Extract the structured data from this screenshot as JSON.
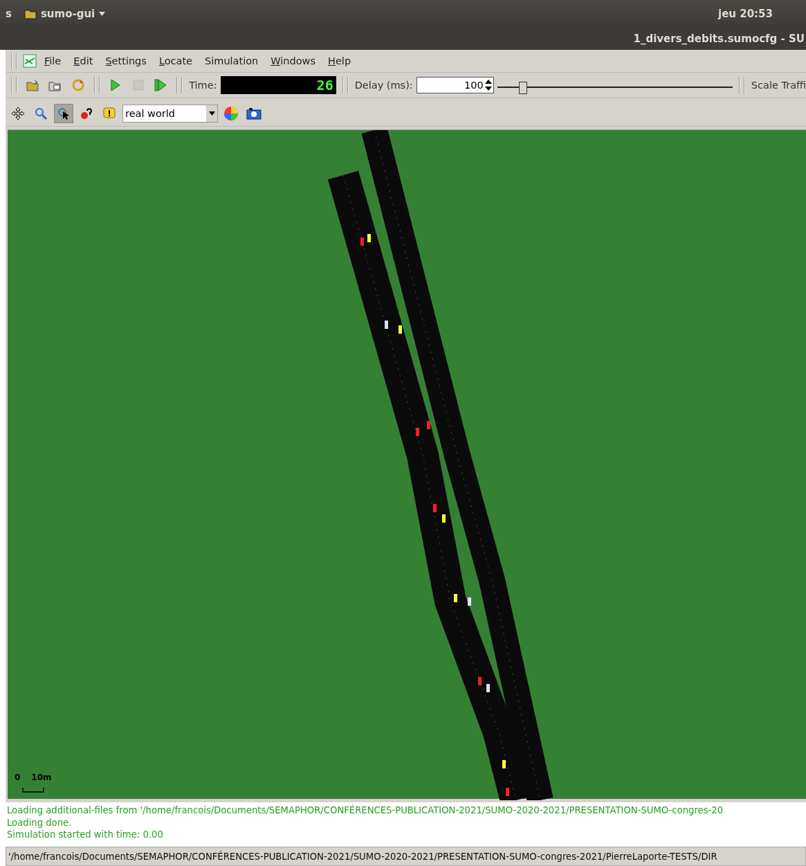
{
  "top_bar": {
    "left_text": "s",
    "app_name": "sumo-gui",
    "clock": "jeu 20:53"
  },
  "window": {
    "title": "1_divers_debits.sumocfg - SU"
  },
  "menu": [
    {
      "label": "File",
      "underline_first": true
    },
    {
      "label": "Edit",
      "underline_first": true
    },
    {
      "label": "Settings",
      "underline_first": true
    },
    {
      "label": "Locate",
      "underline_first": true
    },
    {
      "label": "Simulation",
      "underline_first": false
    },
    {
      "label": "Windows",
      "underline_first": true
    },
    {
      "label": "Help",
      "underline_first": true
    }
  ],
  "sim_toolbar": {
    "buttons": [
      {
        "kind": "open",
        "disabled": false
      },
      {
        "kind": "reload",
        "disabled": false
      },
      {
        "kind": "recycle",
        "disabled": false
      },
      {
        "kind": "run",
        "disabled": false
      },
      {
        "kind": "stop",
        "disabled": true
      },
      {
        "kind": "step",
        "disabled": false
      }
    ],
    "time_label": "Time:",
    "time_value": "26",
    "delay_label": "Delay (ms):",
    "delay_value": "100",
    "delay_slider": {
      "level": 0.11
    },
    "scale_label": "Scale Traffi"
  },
  "view_toolbar": {
    "buttons": [
      {
        "kind": "move",
        "selected": false
      },
      {
        "kind": "zoom",
        "selected": false
      },
      {
        "kind": "select",
        "selected": true
      },
      {
        "kind": "locate",
        "selected": false
      },
      {
        "kind": "warning",
        "selected": false
      }
    ],
    "scheme": "real world",
    "extra": [
      {
        "kind": "colors"
      },
      {
        "kind": "camera"
      }
    ]
  },
  "scale_bar": {
    "zero": "0",
    "distance": "10m"
  },
  "messages": [
    "Loading additional-files from '/home/francois/Documents/SEMAPHOR/CONFÉRENCES-PUBLICATION-2021/SUMO-2020-2021/PRESENTATION-SUMO-congres-20",
    "Loading done.",
    "Simulation started with time: 0.00"
  ],
  "status_bar": "'/home/francois/Documents/SEMAPHOR/CONFÉRENCES-PUBLICATION-2021/SUMO-2020-2021/PRESENTATION-SUMO-congres-2021/PierreLaporte-TESTS/DIR"
}
